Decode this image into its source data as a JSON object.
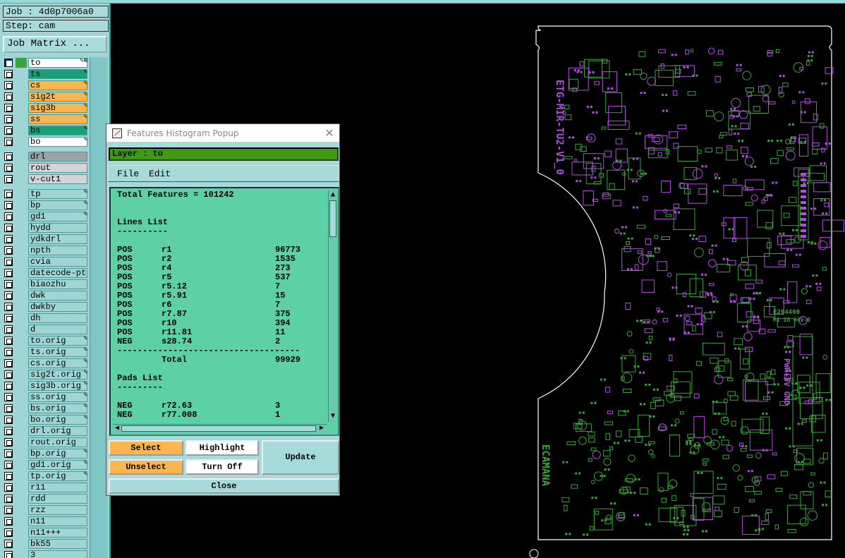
{
  "job": {
    "job_line": "Job : 4d0p7006a0",
    "step_line": "Step: cam",
    "matrix_button": "Job Matrix ..."
  },
  "layers": [
    {
      "name": "to",
      "color": "#ffffff",
      "mark": "✎⊞",
      "active": true
    },
    {
      "name": "ts",
      "color": "#1b9f76",
      "mark": "✎"
    },
    {
      "name": "cs",
      "color": "#fbb74d",
      "mark": "✎"
    },
    {
      "name": "sig2t",
      "color": "#fbb74d",
      "mark": "✎"
    },
    {
      "name": "sig3b",
      "color": "#fbb74d",
      "mark": "✎"
    },
    {
      "name": "ss",
      "color": "#fbb74d",
      "mark": "✎"
    },
    {
      "name": "bs",
      "color": "#1b9f76",
      "mark": "✎"
    },
    {
      "name": "bo",
      "color": "#ffffff",
      "mark": "✎"
    },
    {
      "gap": true
    },
    {
      "name": "drl",
      "color": "#9aa4a4",
      "mark": ""
    },
    {
      "name": "rout",
      "color": "#d5d5d5",
      "mark": ""
    },
    {
      "name": "v-cut1",
      "color": "#d5d5d5",
      "mark": ""
    },
    {
      "gap": true
    },
    {
      "name": "tp",
      "color": "#9fd5d5",
      "mark": "✎"
    },
    {
      "name": "bp",
      "color": "#9fd5d5",
      "mark": "✎"
    },
    {
      "name": "gd1",
      "color": "#9fd5d5",
      "mark": "✎"
    },
    {
      "name": "hydd",
      "color": "#9fd5d5",
      "mark": ""
    },
    {
      "name": "ydkdrl",
      "color": "#9fd5d5",
      "mark": ""
    },
    {
      "name": "npth",
      "color": "#9fd5d5",
      "mark": ""
    },
    {
      "name": "cvia",
      "color": "#9fd5d5",
      "mark": ""
    },
    {
      "name": "datecode-pte",
      "color": "#9fd5d5",
      "mark": ""
    },
    {
      "name": "biaozhu",
      "color": "#9fd5d5",
      "mark": ""
    },
    {
      "name": "dwk",
      "color": "#9fd5d5",
      "mark": ""
    },
    {
      "name": "dwkby",
      "color": "#9fd5d5",
      "mark": ""
    },
    {
      "name": "dh",
      "color": "#9fd5d5",
      "mark": ""
    },
    {
      "name": "d",
      "color": "#9fd5d5",
      "mark": ""
    },
    {
      "name": "to.orig",
      "color": "#9fd5d5",
      "mark": "✎"
    },
    {
      "name": "ts.orig",
      "color": "#9fd5d5",
      "mark": "✎"
    },
    {
      "name": "cs.orig",
      "color": "#9fd5d5",
      "mark": "✎"
    },
    {
      "name": "sig2t.orig",
      "color": "#9fd5d5",
      "mark": "✎"
    },
    {
      "name": "sig3b.orig",
      "color": "#9fd5d5",
      "mark": "✎"
    },
    {
      "name": "ss.orig",
      "color": "#9fd5d5",
      "mark": "✎"
    },
    {
      "name": "bs.orig",
      "color": "#9fd5d5",
      "mark": "✎"
    },
    {
      "name": "bo.orig",
      "color": "#9fd5d5",
      "mark": "✎"
    },
    {
      "name": "drl.orig",
      "color": "#9fd5d5",
      "mark": ""
    },
    {
      "name": "rout.orig",
      "color": "#9fd5d5",
      "mark": ""
    },
    {
      "name": "bp.orig",
      "color": "#9fd5d5",
      "mark": "✎"
    },
    {
      "name": "gd1.orig",
      "color": "#9fd5d5",
      "mark": "✎"
    },
    {
      "name": "tp.orig",
      "color": "#9fd5d5",
      "mark": "✎"
    },
    {
      "name": "r11",
      "color": "#9fd5d5",
      "mark": ""
    },
    {
      "name": "rdd",
      "color": "#9fd5d5",
      "mark": ""
    },
    {
      "name": "rzz",
      "color": "#9fd5d5",
      "mark": ""
    },
    {
      "name": "n11",
      "color": "#9fd5d5",
      "mark": ""
    },
    {
      "name": "n11+++",
      "color": "#9fd5d5",
      "mark": ""
    },
    {
      "name": "bk55",
      "color": "#9fd5d5",
      "mark": ""
    },
    {
      "name": "3",
      "color": "#9fd5d5",
      "mark": ""
    }
  ],
  "popup": {
    "title": "Features Histogram Popup",
    "close_glyph": "✕",
    "layer_label": "Layer :  to",
    "menu": {
      "file": "File",
      "edit": "Edit"
    },
    "report": [
      {
        "c1": "Total Features = 101242"
      },
      {
        "c1": ""
      },
      {
        "c1": ""
      },
      {
        "c1": "Lines List"
      },
      {
        "c1": "----------"
      },
      {
        "c1": ""
      },
      {
        "c1": "POS",
        "c2": "r1",
        "c3": "96773"
      },
      {
        "c1": "POS",
        "c2": "r2",
        "c3": "1535"
      },
      {
        "c1": "POS",
        "c2": "r4",
        "c3": "273"
      },
      {
        "c1": "POS",
        "c2": "r5",
        "c3": "537"
      },
      {
        "c1": "POS",
        "c2": "r5.12",
        "c3": "7"
      },
      {
        "c1": "POS",
        "c2": "r5.91",
        "c3": "15"
      },
      {
        "c1": "POS",
        "c2": "r6",
        "c3": "7"
      },
      {
        "c1": "POS",
        "c2": "r7.87",
        "c3": "375"
      },
      {
        "c1": "POS",
        "c2": "r10",
        "c3": "394"
      },
      {
        "c1": "POS",
        "c2": "r11.81",
        "c3": "11"
      },
      {
        "c1": "NEG",
        "c2": "s28.74",
        "c3": "2"
      },
      {
        "c1": "------------------------------------"
      },
      {
        "c1": "",
        "c2": "Total",
        "c3": "99929"
      },
      {
        "c1": ""
      },
      {
        "c1": "Pads List"
      },
      {
        "c1": "---------"
      },
      {
        "c1": ""
      },
      {
        "c1": "NEG",
        "c2": "r72.63",
        "c3": "3"
      },
      {
        "c1": "NEG",
        "c2": "r77.008",
        "c3": "1"
      }
    ],
    "scroll": {
      "up": "▲",
      "down": "▼",
      "left": "◀",
      "right": "▶"
    },
    "buttons": {
      "select": "Select",
      "unselect": "Unselect",
      "highlight": "Highlight",
      "turn_off": "Turn Off",
      "update": "Update",
      "close": "Close"
    }
  },
  "pcb": {
    "text_top": "ETG-MIR-TU2-V1_0",
    "text_pwr": "PWR+8V GND",
    "text_logo": "E204460",
    "text_logo2": "M1 1G 94V-0",
    "text_brand": "ECAMANA",
    "colors": {
      "green": "#3aa53a",
      "purple": "#b24fe0",
      "outline": "#ffffff"
    }
  }
}
